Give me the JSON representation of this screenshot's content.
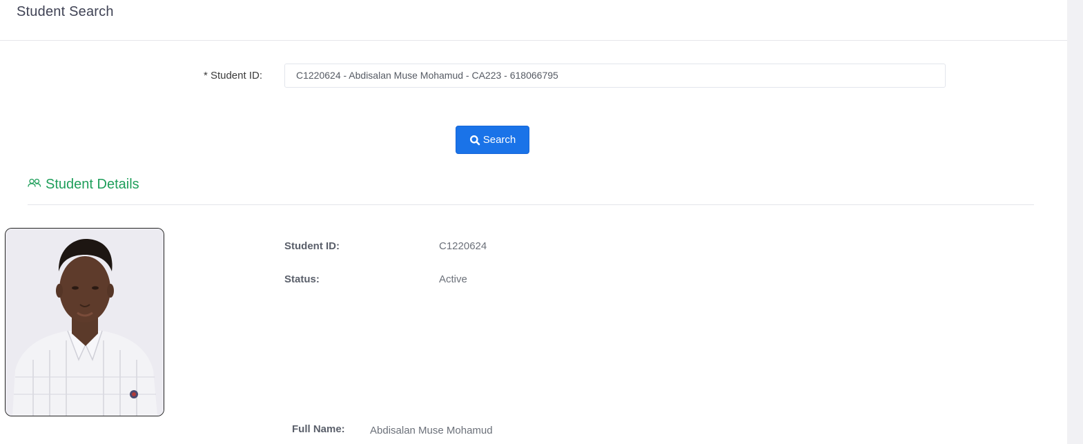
{
  "header": {
    "title": "Student Search"
  },
  "search_form": {
    "student_id_label": "* Student ID:",
    "student_id_value": "C1220624 - Abdisalan Muse Mohamud - CA223 - 618066795",
    "search_button_label": "Search"
  },
  "student_details": {
    "section_title": "Student Details",
    "fields": [
      {
        "label": "Student ID:",
        "value": "C1220624"
      },
      {
        "label": "Status:",
        "value": "Active"
      },
      {
        "label": "Full Name:",
        "value": "Abdisalan Muse Mohamud"
      }
    ]
  },
  "colors": {
    "primary_button": "#1a73e8",
    "section_accent": "#1e9e5a"
  },
  "icons": {
    "search_button_icon": "search-icon",
    "section_icon": "users-icon"
  }
}
